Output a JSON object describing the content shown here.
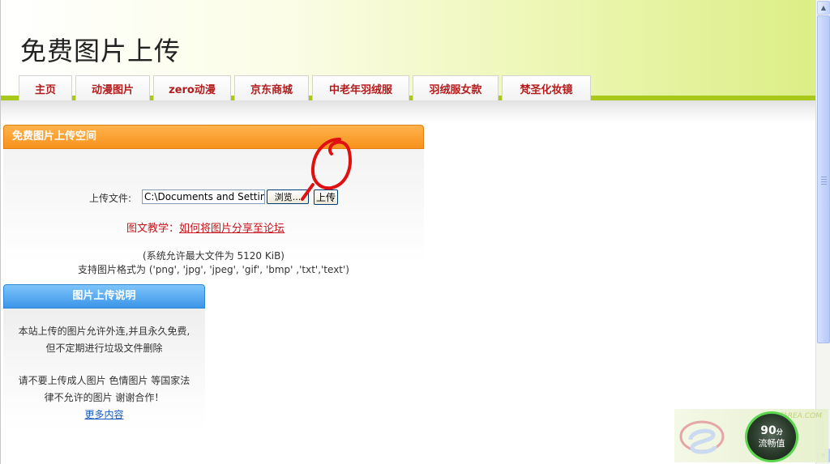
{
  "header": {
    "title": "免费图片上传",
    "nav": [
      "主页",
      "动漫图片",
      "zero动漫",
      "京东商城",
      "中老年羽绒服",
      "羽绒服女款",
      "梵圣化妆镜"
    ]
  },
  "upload_panel": {
    "title": "免费图片上传空间",
    "file_label": "上传文件:",
    "file_value": "C:\\Documents and Settings",
    "browse_label": "浏览...",
    "upload_label": "上传",
    "tutorial_prefix": "图文教学：",
    "tutorial_link": "如何将图片分享至论坛",
    "max_size_text": "(系统允许最大文件为  5120 KiB)",
    "formats_text": "支持图片格式为  ('png', 'jpg', 'jpeg', 'gif', 'bmp' ,'txt','text')"
  },
  "info_panel": {
    "title": "图片上传说明",
    "para1": "本站上传的图片允许外连,并且永久免费,但不定期进行垃圾文件删除",
    "para2": "请不要上传成人图片 色情图片 等国家法律不允许的图片 谢谢合作！",
    "more_link": "更多内容"
  },
  "overlay": {
    "watermark_text": "SOFTAREA.COM",
    "gauge_value": "90",
    "gauge_unit": "分",
    "gauge_label": "流畅值"
  },
  "colors": {
    "nav_text": "#b31c1c",
    "orange_header": "#f7921c",
    "blue_header": "#3b95e8",
    "tutorial_red": "#c8161d",
    "annotation_red": "#e01010"
  }
}
